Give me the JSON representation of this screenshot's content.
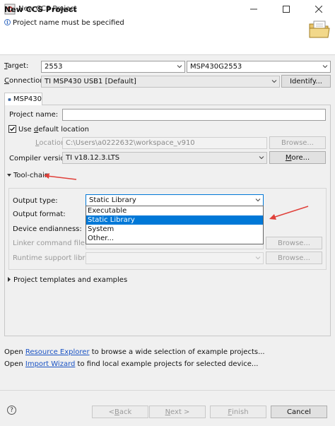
{
  "window": {
    "title": "New CCS Project"
  },
  "header": {
    "title": "New CCS Project",
    "message": "Project name must be specified"
  },
  "target": {
    "label_pre": "",
    "label_u": "T",
    "label_post": "arget:",
    "value": "2553",
    "device": "MSP430G2553"
  },
  "connection": {
    "label_u": "C",
    "label_post": "onnection:",
    "value": "TI MSP430 USB1 [Default]",
    "button": "Identify..."
  },
  "tab": {
    "label": "MSP430"
  },
  "project_name": {
    "label": "Project name:",
    "value": ""
  },
  "default_location": {
    "label_pre": "Use ",
    "label_u": "d",
    "label_post": "efault location",
    "checked": true
  },
  "location": {
    "label_u": "L",
    "label_post": "ocation:",
    "value": "C:\\Users\\a0222632\\workspace_v910",
    "button": "Browse..."
  },
  "compiler": {
    "label": "Compiler version:",
    "value": "TI v18.12.3.LTS",
    "button_u": "M",
    "button_post": "ore..."
  },
  "toolchain": {
    "title": "Tool-chain",
    "output_type_label": "Output type:",
    "output_type_value": "Static Library",
    "output_format_label": "Output format:",
    "endianness_label": "Device endianness:",
    "linker_label": "Linker command file:",
    "linker_button": "Browse...",
    "runtime_label": "Runtime support library:",
    "runtime_button": "Browse...",
    "options": [
      "Executable",
      "Static Library",
      "System",
      "Other..."
    ]
  },
  "templates": {
    "title": "Project templates and examples"
  },
  "links": {
    "line1_pre": "Open ",
    "line1_link": "Resource Explorer",
    "line1_post": " to browse a wide selection of example projects...",
    "line2_pre": "Open ",
    "line2_link": "Import Wizard",
    "line2_post": " to find local example projects for selected device..."
  },
  "buttons": {
    "back_pre": "< ",
    "back_u": "B",
    "back_post": "ack",
    "next_u": "N",
    "next_post": "ext >",
    "finish_u": "F",
    "finish_post": "inish",
    "cancel": "Cancel"
  },
  "colors": {
    "accent": "#0078d7",
    "link": "#1a53c4",
    "annotation_arrow": "#e0403a"
  }
}
